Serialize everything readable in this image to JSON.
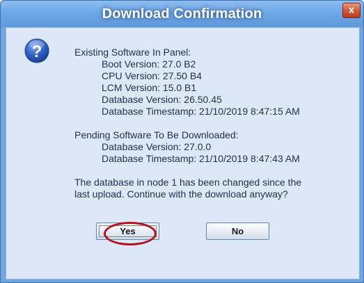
{
  "window": {
    "title": "Download Confirmation",
    "close_label": "x"
  },
  "icon": {
    "name": "question-icon",
    "glyph": "?"
  },
  "message": {
    "existing_header": "Existing Software In Panel:",
    "existing_items": [
      "Boot Version:  27.0 B2",
      "CPU Version: 27.50 B4",
      "LCM Version: 15.0 B1",
      "Database Version: 26.50.45",
      "Database Timestamp: 21/10/2019 8:47:15 AM"
    ],
    "pending_header": "Pending Software To Be Downloaded:",
    "pending_items": [
      "Database Version: 27.0.0",
      "Database Timestamp: 21/10/2019 8:47:43 AM"
    ],
    "question_lines": [
      "The database in node 1 has been changed since the",
      "last upload.  Continue with the download anyway?"
    ]
  },
  "buttons": {
    "yes_label": "Yes",
    "no_label": "No"
  },
  "colors": {
    "frame": "#6fa6e2",
    "content_bg": "#dce8f7",
    "annotation": "#b5121b",
    "close": "#c8462a"
  }
}
